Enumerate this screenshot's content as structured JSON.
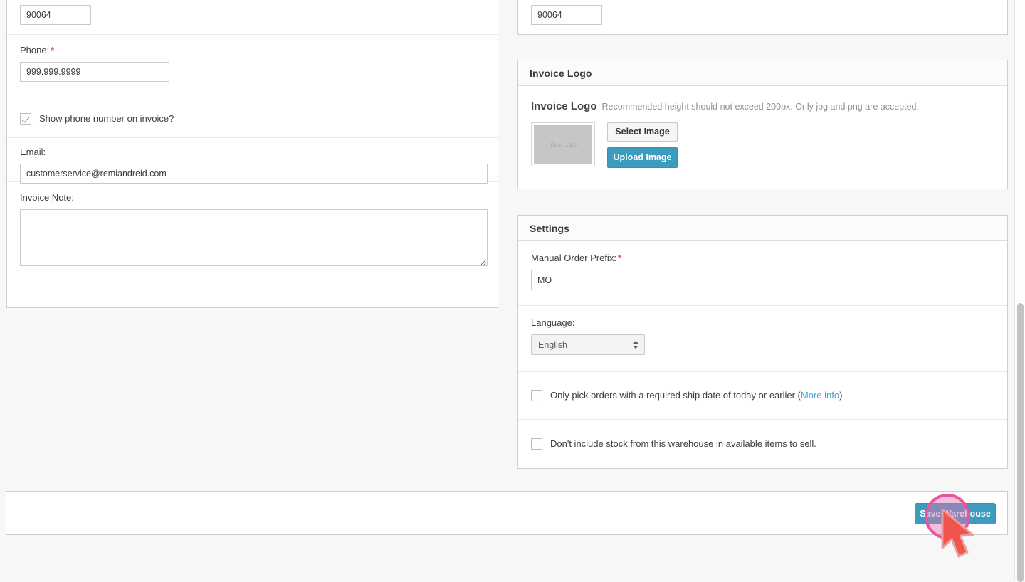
{
  "left_panel": {
    "zip": {
      "value": "90064"
    },
    "phone": {
      "label": "Phone:",
      "required": "*",
      "value": "999.999.9999"
    },
    "show_phone": {
      "label": "Show phone number on invoice?",
      "checked": true
    },
    "email": {
      "label": "Email:",
      "value": "customerservice@remiandreid.com"
    },
    "invoice_note": {
      "label": "Invoice Note:",
      "value": "",
      "placeholder": ""
    }
  },
  "right_panel": {
    "zip": {
      "value": "90064"
    },
    "invoice_logo_section": {
      "heading": "Invoice Logo",
      "block_title": "Invoice Logo",
      "hint": "Recommended height should not exceed 200px. Only jpg and png are accepted.",
      "thumb_text": "Your Logo",
      "select_image_label": "Select Image",
      "upload_image_label": "Upload Image"
    },
    "settings_section": {
      "heading": "Settings",
      "manual_order_prefix": {
        "label": "Manual Order Prefix:",
        "required": "*",
        "value": "MO"
      },
      "language": {
        "label": "Language:",
        "selected": "English"
      },
      "checkbox_ship_date": {
        "text_before": "Only pick orders with a required ship date of today or earlier (",
        "link": "More info",
        "text_after": ")",
        "checked": false
      },
      "checkbox_exclude_stock": {
        "text": "Don't include stock from this warehouse in available items to sell.",
        "checked": false
      }
    }
  },
  "footer": {
    "save_label": "Save Warehouse"
  },
  "colors": {
    "primary": "#3d9cbd",
    "link": "#4aa3d0",
    "required": "#d9534f",
    "cursor_halo": "#e8559f",
    "cursor_arrow": "#f0544c"
  }
}
